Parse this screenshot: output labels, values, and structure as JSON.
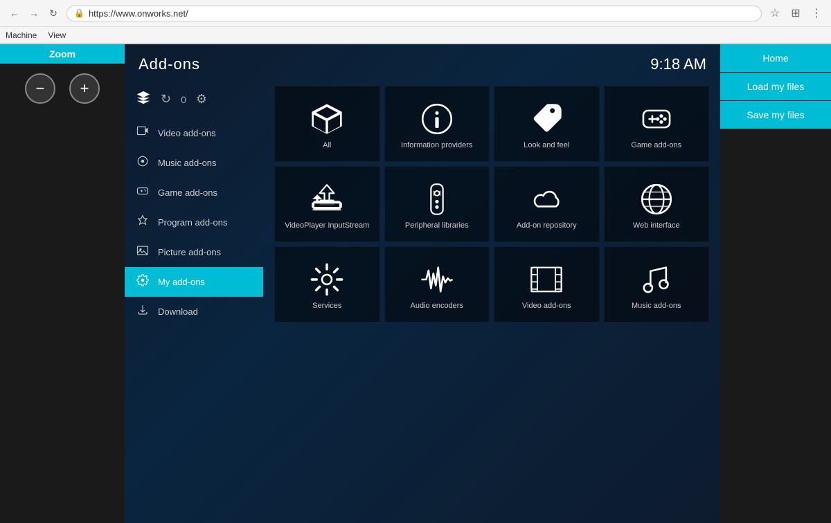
{
  "browser": {
    "url": "https://www.onworks.net/",
    "menu_items": [
      "Machine",
      "View"
    ]
  },
  "zoom_panel": {
    "title": "Zoom",
    "minus_label": "−",
    "plus_label": "+"
  },
  "right_panel": {
    "home_label": "Home",
    "load_label": "Load my files",
    "save_label": "Save my files"
  },
  "kodi": {
    "title": "Add-ons",
    "time": "9:18 AM",
    "sidebar": {
      "counter": "0",
      "items": [
        {
          "id": "video-add-ons",
          "label": "Video add-ons",
          "icon": "🎬"
        },
        {
          "id": "music-add-ons",
          "label": "Music add-ons",
          "icon": "🎵"
        },
        {
          "id": "game-add-ons",
          "label": "Game add-ons",
          "icon": "🎮"
        },
        {
          "id": "program-add-ons",
          "label": "Program add-ons",
          "icon": "⚙"
        },
        {
          "id": "picture-add-ons",
          "label": "Picture add-ons",
          "icon": "🖼"
        },
        {
          "id": "my-add-ons",
          "label": "My add-ons",
          "icon": "⚙",
          "active": true
        },
        {
          "id": "download",
          "label": "Download",
          "icon": "☁"
        }
      ]
    },
    "grid": [
      {
        "id": "all",
        "label": "All",
        "icon": "box"
      },
      {
        "id": "information-providers",
        "label": "Information providers",
        "icon": "info"
      },
      {
        "id": "look-and-feel",
        "label": "Look and feel",
        "icon": "tag"
      },
      {
        "id": "game-add-ons",
        "label": "Game add-ons",
        "icon": "gamepad"
      },
      {
        "id": "videoplayer-inputstream",
        "label": "VideoPlayer InputStream",
        "icon": "upload"
      },
      {
        "id": "peripheral-libraries",
        "label": "Peripheral libraries",
        "icon": "remote"
      },
      {
        "id": "add-on-repository",
        "label": "Add-on repository",
        "icon": "cloud"
      },
      {
        "id": "web-interface",
        "label": "Web interface",
        "icon": "globe"
      },
      {
        "id": "services",
        "label": "Services",
        "icon": "gear"
      },
      {
        "id": "audio-encoders",
        "label": "Audio encoders",
        "icon": "waveform"
      },
      {
        "id": "video-add-ons-tile",
        "label": "Video add-ons",
        "icon": "film"
      },
      {
        "id": "music-add-ons-tile",
        "label": "Music add-ons",
        "icon": "music"
      }
    ]
  }
}
